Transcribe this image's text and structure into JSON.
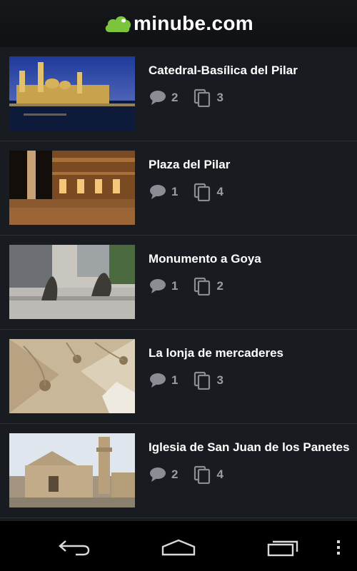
{
  "app": {
    "logo_text": "minube.com",
    "brand_color": "#7cc43b"
  },
  "places": [
    {
      "title": "Catedral-Basílica del Pilar",
      "comments": "2",
      "photos": "3"
    },
    {
      "title": "Plaza del Pilar",
      "comments": "1",
      "photos": "4"
    },
    {
      "title": "Monumento a Goya",
      "comments": "1",
      "photos": "2"
    },
    {
      "title": "La lonja de mercaderes",
      "comments": "1",
      "photos": "3"
    },
    {
      "title": "Iglesia de San Juan de los Panetes",
      "comments": "2",
      "photos": "4"
    }
  ],
  "icons": {
    "comments": "comment-bubble-icon",
    "photos": "photos-stack-icon"
  },
  "navbar": {
    "back": "back-icon",
    "home": "home-icon",
    "recents": "recent-apps-icon",
    "menu": "overflow-menu-icon"
  }
}
